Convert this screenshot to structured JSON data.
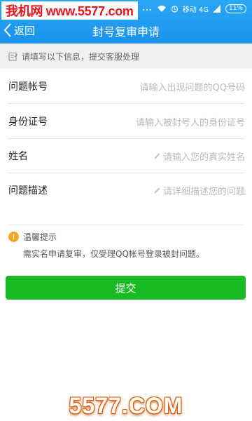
{
  "watermark": {
    "top": "我机网 www.5577.com",
    "bottom": "5577.COM"
  },
  "status": {
    "dots": "...",
    "carrier": "移动 4G",
    "battery": "11%"
  },
  "nav": {
    "back_label": "返回",
    "title": "封号复审申请"
  },
  "notice": {
    "text": "请填写以下信息，提交客服处理"
  },
  "form": {
    "rows": [
      {
        "label": "问题帐号",
        "placeholder": "请输入出现问题的QQ号码"
      },
      {
        "label": "身份证号",
        "placeholder": "请输入被封号人的身份证号"
      },
      {
        "label": "姓名",
        "placeholder": "请输入您的真实姓名"
      },
      {
        "label": "问题描述",
        "placeholder": "请详细描述您的问题"
      }
    ]
  },
  "tip": {
    "icon_glyph": "!",
    "title": "温馨提示",
    "text": "需实名申请复审，仅受理QQ帐号登录被封问题。"
  },
  "submit": {
    "label": "提交"
  },
  "colors": {
    "header": "#1a93ec",
    "submit": "#19bb24",
    "tip_icon": "#f5a623",
    "watermark": "#e8141c"
  }
}
